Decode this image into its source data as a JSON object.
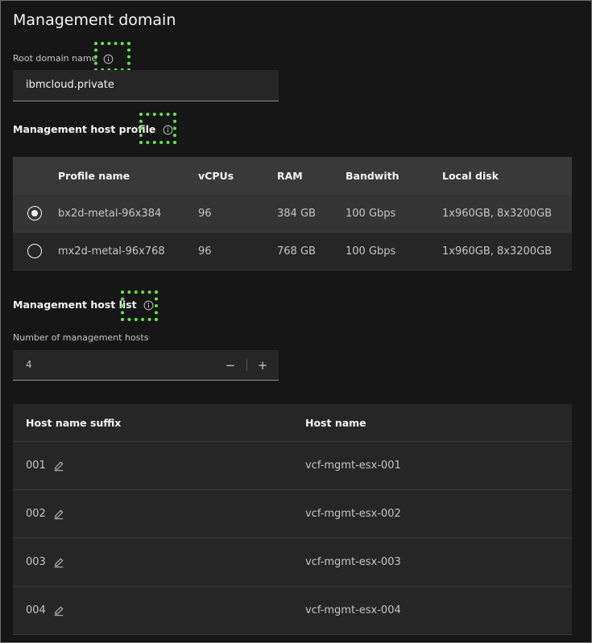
{
  "title": "Management domain",
  "root_domain": {
    "label": "Root domain name",
    "value": "ibmcloud.private"
  },
  "profile_section": {
    "heading": "Management host profile",
    "columns": [
      "Profile name",
      "vCPUs",
      "RAM",
      "Bandwith",
      "Local disk"
    ],
    "rows": [
      {
        "selected": true,
        "cells": [
          "bx2d-metal-96x384",
          "96",
          "384 GB",
          "100 Gbps",
          "1x960GB, 8x3200GB"
        ]
      },
      {
        "selected": false,
        "cells": [
          "mx2d-metal-96x768",
          "96",
          "768 GB",
          "100 Gbps",
          "1x960GB, 8x3200GB"
        ]
      }
    ]
  },
  "host_list": {
    "heading": "Management host list",
    "count_label": "Number of management hosts",
    "count_value": "4",
    "decrement": "−",
    "increment": "+",
    "columns": [
      "Host name suffix",
      "Host name"
    ],
    "rows": [
      {
        "suffix": "001",
        "host": "vcf-mgmt-esx-001"
      },
      {
        "suffix": "002",
        "host": "vcf-mgmt-esx-002"
      },
      {
        "suffix": "003",
        "host": "vcf-mgmt-esx-003"
      },
      {
        "suffix": "004",
        "host": "vcf-mgmt-esx-004"
      }
    ]
  },
  "colors": {
    "background": "#161616",
    "field": "#262626",
    "table_header": "#393939",
    "highlight": "#62e34a"
  }
}
